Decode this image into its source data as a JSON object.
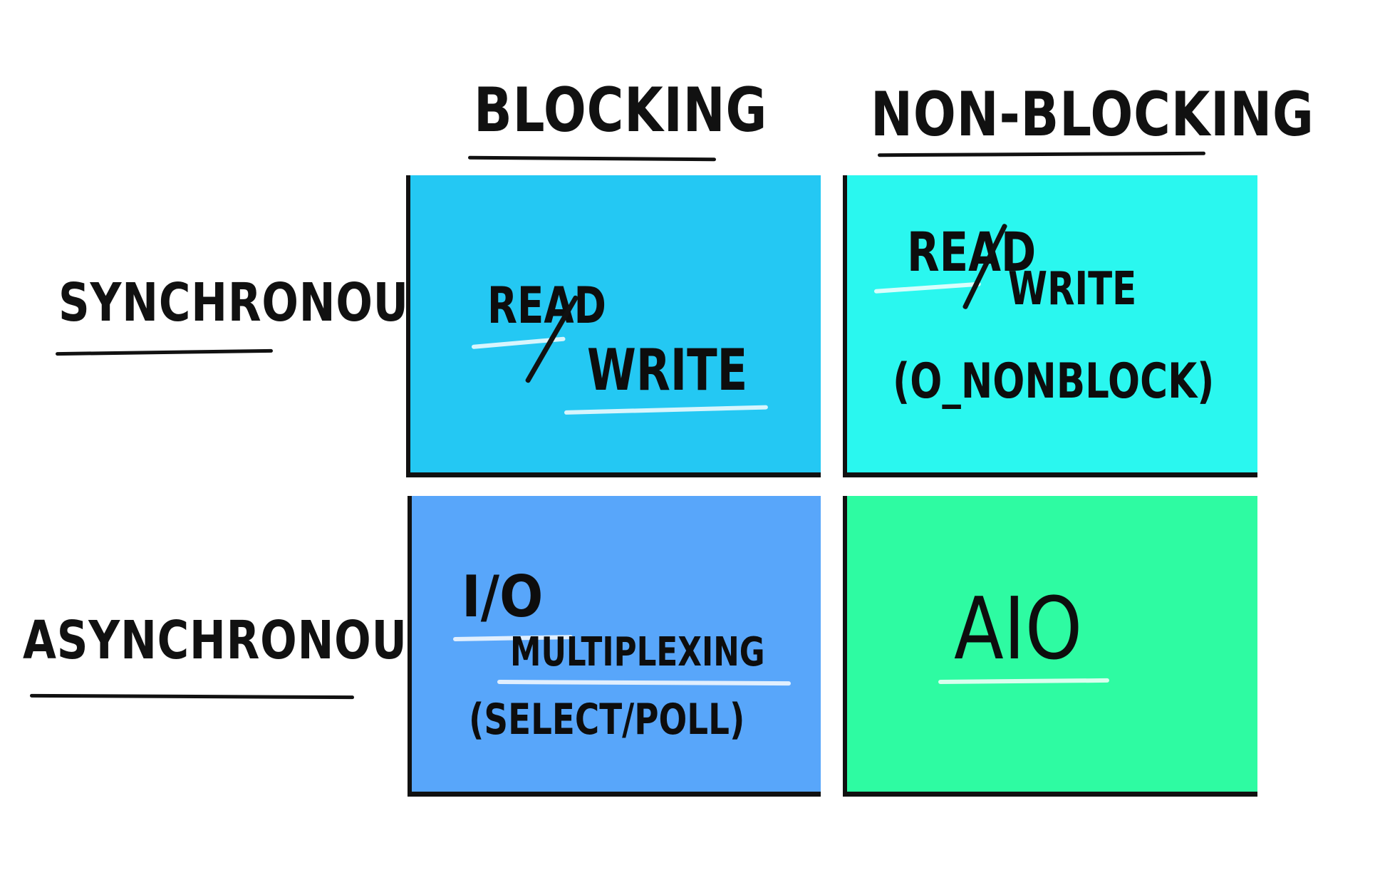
{
  "columns": {
    "blocking": "BLOCKING",
    "non_blocking": "NON-BLOCKING"
  },
  "rows": {
    "synchronous": "SYNCHRONOUS",
    "asynchronous": "ASYNCHRONOUS"
  },
  "cells": {
    "sync_blocking": {
      "line1": "READ",
      "line2": "WRITE",
      "color": "#24C8F3"
    },
    "sync_nonblocking": {
      "line1": "READ",
      "line2": "WRITE",
      "line3": "(O_NONBLOCK)",
      "color": "#2AF7EF"
    },
    "async_blocking": {
      "line1": "I/O",
      "line2": "MULTIPLEXING",
      "line3": "(SELECT/POLL)",
      "color": "#58A6FA"
    },
    "async_nonblocking": {
      "line1": "AIO",
      "color": "#2EFBA2"
    }
  }
}
